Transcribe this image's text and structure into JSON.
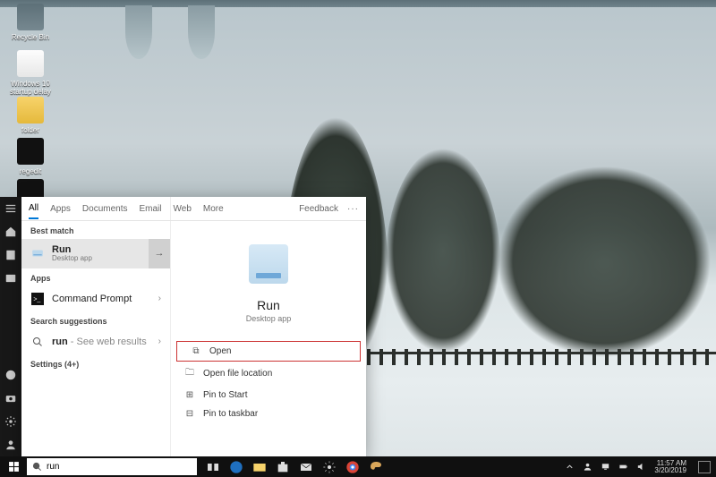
{
  "desktop": {
    "icons": [
      {
        "name": "recycle-bin",
        "label": "Recycle Bin"
      },
      {
        "name": "startup-shortcut",
        "label": "Windows 10 startup delay"
      },
      {
        "name": "folder",
        "label": "folder"
      },
      {
        "name": "regedit",
        "label": "regedit"
      },
      {
        "name": "cmd",
        "label": ""
      }
    ]
  },
  "edge_strip": [
    "menu-icon",
    "home-icon",
    "grid-icon",
    "layers-icon",
    "spacer",
    "user-icon",
    "camera-icon",
    "settings-icon",
    "user2-icon"
  ],
  "search": {
    "tabs": [
      "All",
      "Apps",
      "Documents",
      "Email",
      "Web",
      "More"
    ],
    "feedback": "Feedback",
    "best_match_label": "Best match",
    "best": {
      "title": "Run",
      "subtitle": "Desktop app"
    },
    "apps_label": "Apps",
    "apps": [
      {
        "title": "Command Prompt"
      }
    ],
    "suggestions_label": "Search suggestions",
    "suggestions": [
      {
        "prefix": "run",
        "suffix": " - See web results"
      }
    ],
    "settings_label": "Settings (4+)",
    "hero": {
      "title": "Run",
      "subtitle": "Desktop app"
    },
    "actions": {
      "open": "Open",
      "open_loc": "Open file location",
      "pin_start": "Pin to Start",
      "pin_taskbar": "Pin to taskbar"
    }
  },
  "taskbar": {
    "search_value": "run",
    "apps": [
      "task-view",
      "edge",
      "file-explorer",
      "store",
      "mail",
      "settings",
      "chrome",
      "paint"
    ],
    "tray": [
      "up",
      "people",
      "network",
      "battery",
      "volume"
    ],
    "time": "11:57 AM",
    "date": "3/20/2019"
  }
}
